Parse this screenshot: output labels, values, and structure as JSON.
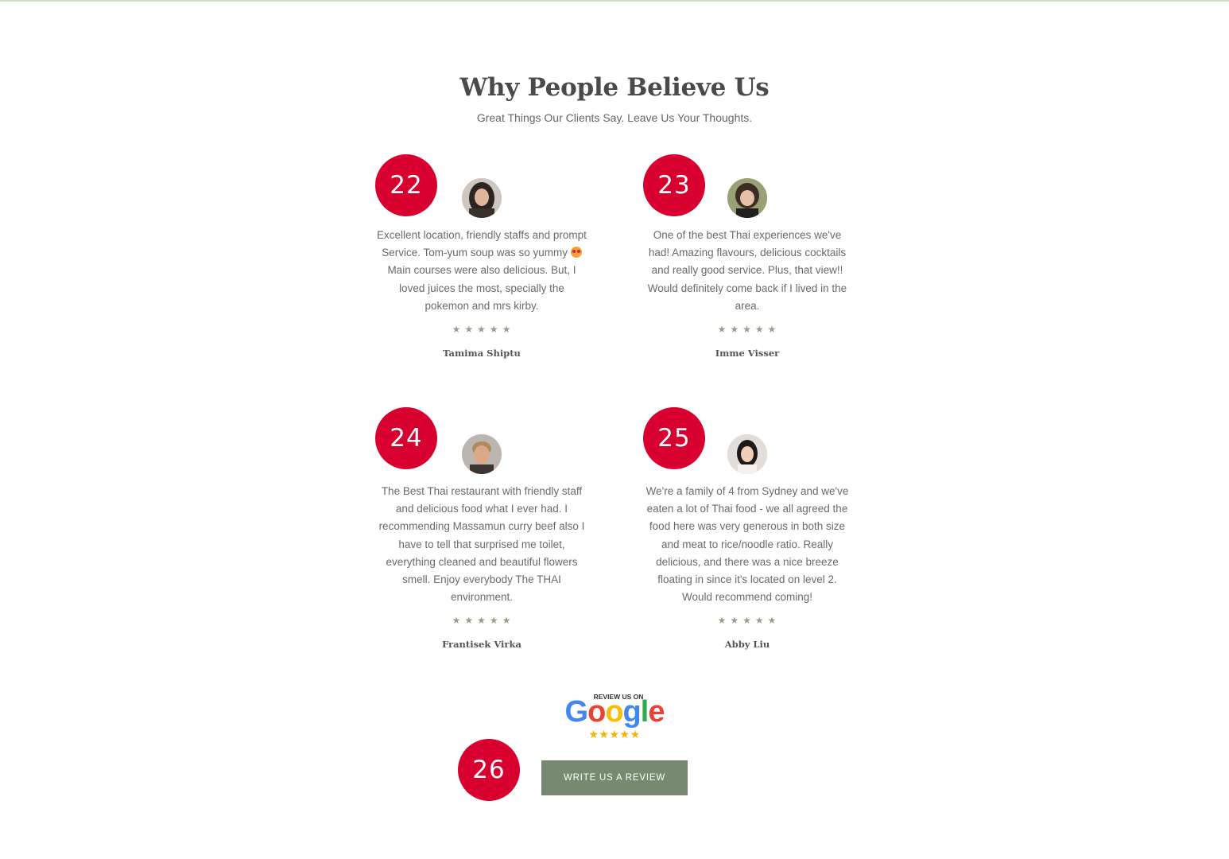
{
  "section": {
    "title": "Why People Believe Us",
    "subtitle": "Great Things Our Clients Say. Leave Us Your Thoughts."
  },
  "reviews": [
    {
      "badge": "22",
      "text_before_emoji": "Excellent location, friendly staffs and prompt Service. Tom-yum soup was so yummy",
      "text_after_emoji": "Main courses were also delicious. But, I loved juices the most, specially the pokemon and mrs kirby.",
      "stars": "★★★★★",
      "rating": 5,
      "name": "Tamima Shiptu"
    },
    {
      "badge": "23",
      "text": "One of the best Thai experiences we've had! Amazing flavours, delicious cocktails and really good service. Plus, that view!! Would definitely come back if I lived in the area.",
      "stars": "★★★★★",
      "rating": 5,
      "name": "Imme Visser"
    },
    {
      "badge": "24",
      "text": "The Best Thai restaurant with friendly staff and delicious food what I ever had. I recommending Massamun curry beef also I have to tell that surprised me toilet, everything cleaned and beautiful flowers smell. Enjoy everybody The THAI environment.",
      "stars": "★★★★★",
      "rating": 5,
      "name": "Frantisek Virka"
    },
    {
      "badge": "25",
      "text": "We're a family of 4 from Sydney and we've eaten a lot of Thai food - we all agreed the food here was very generous in both size and meat to rice/noodle ratio. Really delicious, and there was a nice breeze floating in since it's located on level 2. Would recommend coming!",
      "stars": "★★★★★",
      "rating": 5,
      "name": "Abby Liu"
    }
  ],
  "google": {
    "top_text": "REVIEW US ON",
    "wordmark": "Google",
    "stars": "★★★★★"
  },
  "cta": {
    "badge": "26",
    "label": "WRITE US A REVIEW"
  },
  "colors": {
    "badge": "#d7002f",
    "button": "#778a71",
    "stars": "#8fa38b",
    "google_star": "#f4b400"
  }
}
